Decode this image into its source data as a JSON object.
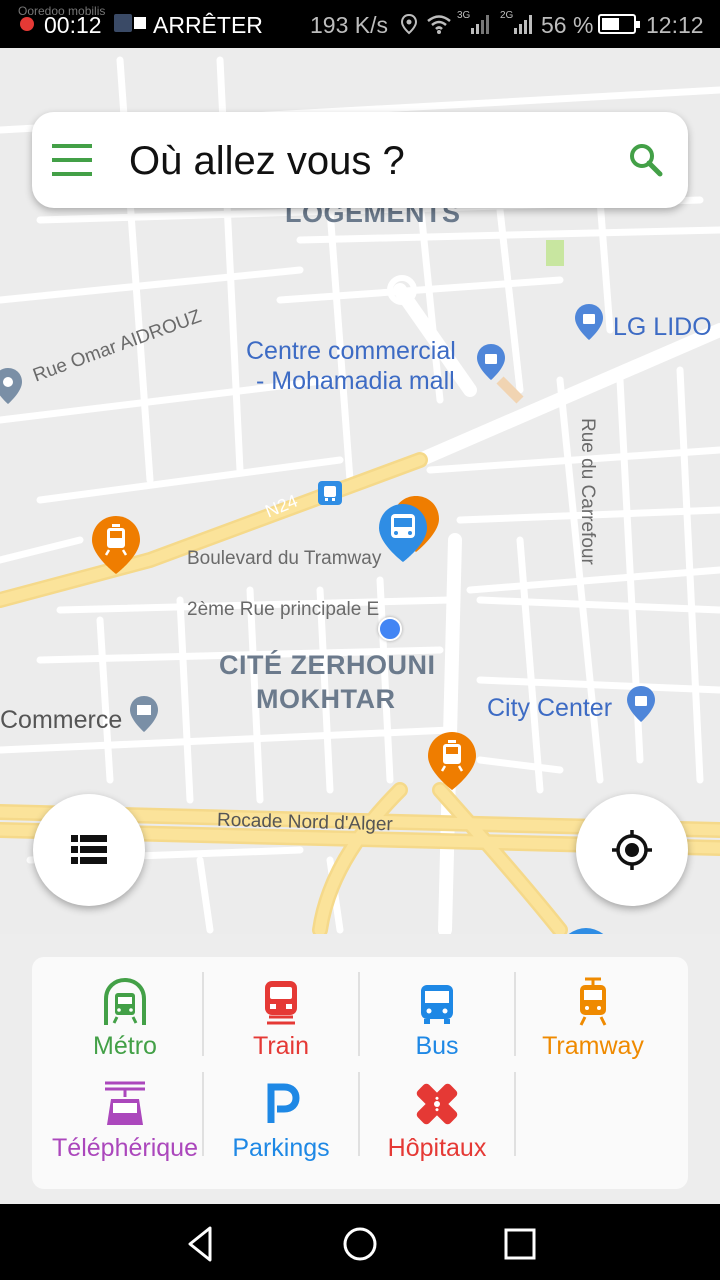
{
  "status_bar": {
    "carrier": "Ooredoo mobilis",
    "record_time": "00:12",
    "stop_label": "ARRÊTER",
    "net_speed": "193 K/s",
    "signal1_label": "3G",
    "signal2_label": "2G",
    "battery_percent": "56 %",
    "battery_level": 0.56,
    "clock": "12:12"
  },
  "search": {
    "placeholder": "Où allez vous ?"
  },
  "map": {
    "labels": {
      "logements": "LOGEMENTS",
      "lg_lido": "LG LIDO",
      "mall_line1": "Centre commercial",
      "mall_line2": "- Mohamadia mall",
      "rue_omar": "Rue Omar AIDROUZ",
      "rue_carrefour": "Rue du Carrefour",
      "n24": "N24",
      "boulevard_tramway": "Boulevard du Tramway",
      "rue_principale": "2ème Rue principale E",
      "cite_line1": "CITÉ ZERHOUNI",
      "cite_line2": "MOKHTAR",
      "commerce": "Commerce",
      "city_center": "City Center",
      "rocade": "Rocade Nord d'Alger"
    }
  },
  "categories": [
    {
      "label": "Métro",
      "icon": "metro-icon",
      "color": "#43a047"
    },
    {
      "label": "Train",
      "icon": "train-icon",
      "color": "#e53935"
    },
    {
      "label": "Bus",
      "icon": "bus-icon",
      "color": "#1e88e5"
    },
    {
      "label": "Tramway",
      "icon": "tramway-icon",
      "color": "#ef8a00"
    },
    {
      "label": "Téléphérique",
      "icon": "cable-car-icon",
      "color": "#ab47bc"
    },
    {
      "label": "Parkings",
      "icon": "parking-icon",
      "color": "#1e88e5"
    },
    {
      "label": "Hôpitaux",
      "icon": "hospital-icon",
      "color": "#e53935"
    }
  ],
  "colors": {
    "accent_green": "#43a047",
    "map_background": "#ececec",
    "highway": "#fbe39a"
  }
}
